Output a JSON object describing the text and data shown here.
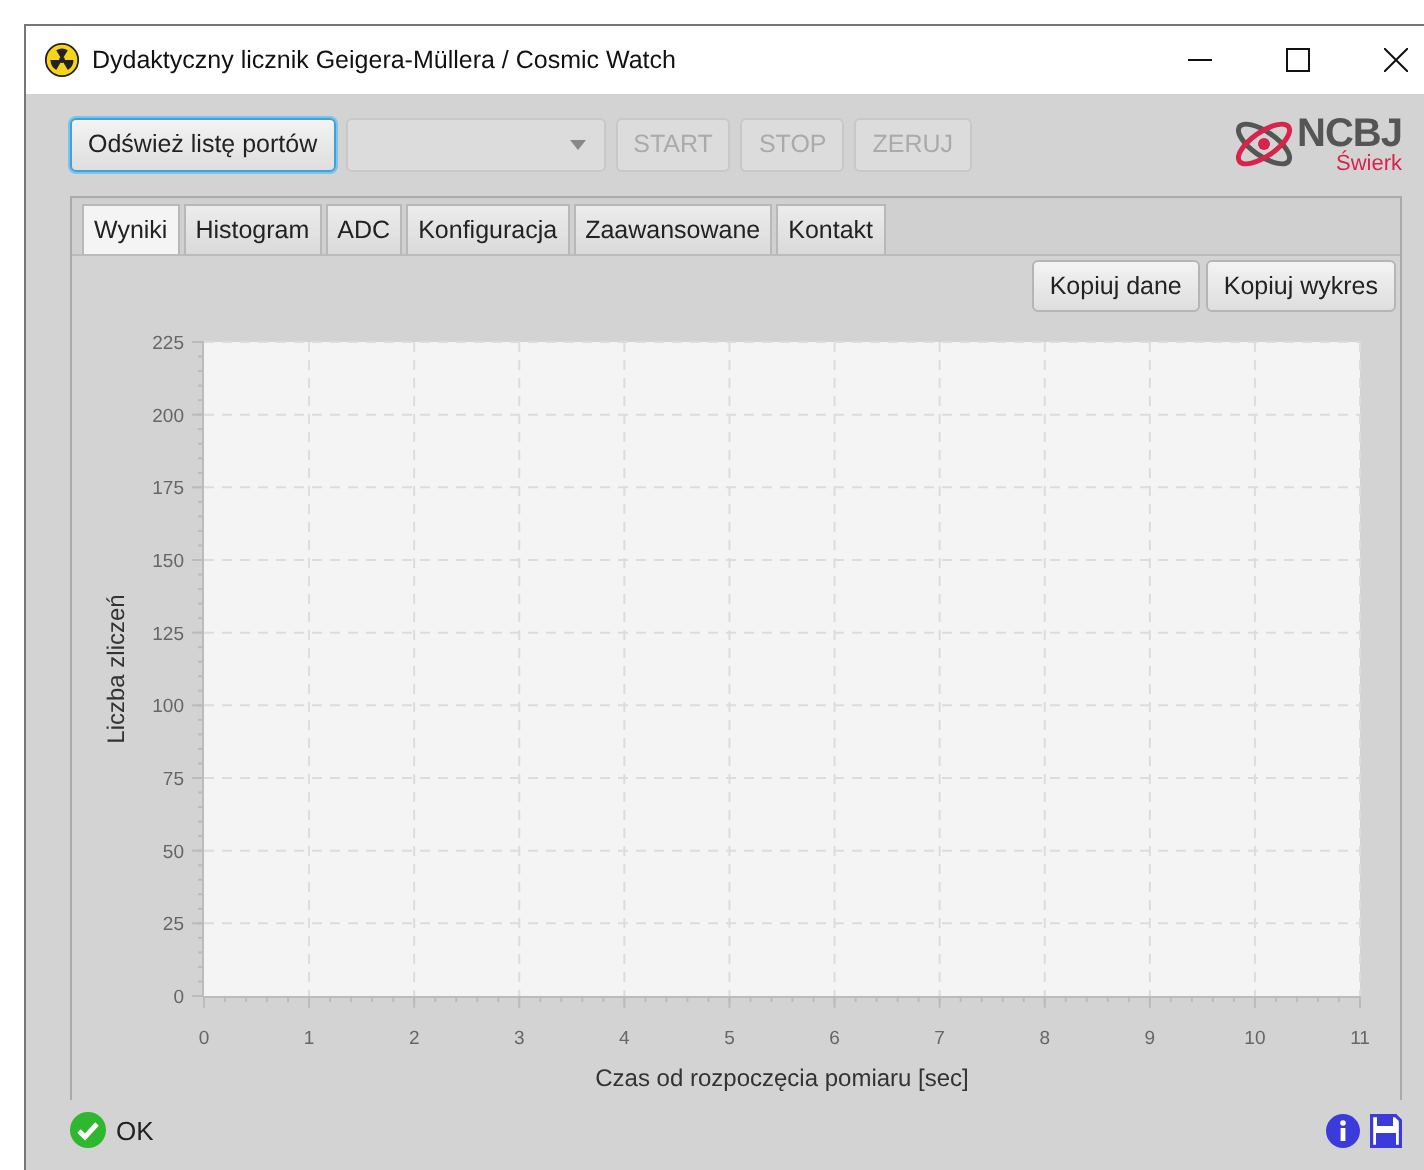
{
  "window": {
    "title": "Dydaktyczny licznik Geigera-Müllera / Cosmic Watch"
  },
  "toolbar": {
    "buttons": [
      {
        "label": "Odśwież listę portów",
        "disabled": false,
        "focused": true
      },
      {
        "label": "START",
        "disabled": true,
        "focused": false
      },
      {
        "label": "STOP",
        "disabled": true,
        "focused": false
      },
      {
        "label": "ZERUJ",
        "disabled": true,
        "focused": false
      }
    ],
    "port_select": {
      "disabled": true
    }
  },
  "logo": {
    "name": "NCBJ",
    "place": "Świerk"
  },
  "tabs": [
    {
      "label": "Wyniki",
      "selected": true
    },
    {
      "label": "Histogram",
      "selected": false
    },
    {
      "label": "ADC",
      "selected": false
    },
    {
      "label": "Konfiguracja",
      "selected": false
    },
    {
      "label": "Zaawansowane",
      "selected": false
    },
    {
      "label": "Kontakt",
      "selected": false
    }
  ],
  "actions": [
    "Kopiuj dane",
    "Kopiuj wykres"
  ],
  "chart_data": {
    "type": "line",
    "xlabel": "Czas od rozpoczęcia pomiaru [sec]",
    "ylabel": "Liczba zliczeń",
    "xlim": [
      0,
      11
    ],
    "ylim": [
      0,
      225
    ],
    "xticks": [
      0,
      1,
      2,
      3,
      4,
      5,
      6,
      7,
      8,
      9,
      10,
      11
    ],
    "yticks": [
      0,
      25,
      50,
      75,
      100,
      125,
      150,
      175,
      200,
      225
    ],
    "grid": true
  },
  "status_bar": {
    "text": "OK"
  }
}
